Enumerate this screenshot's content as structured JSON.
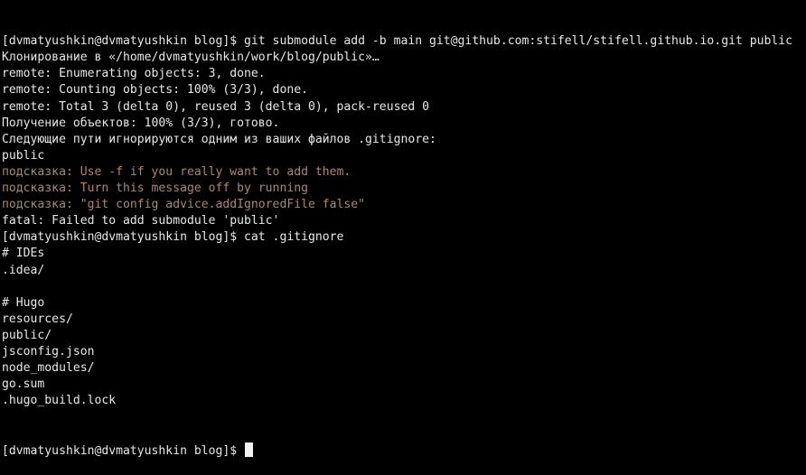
{
  "terminal": {
    "lines": [
      {
        "text": "[dvmatyushkin@dvmatyushkin blog]$ git submodule add -b main git@github.com:stifell/stifell.github.io.git public",
        "kind": "normal"
      },
      {
        "text": "Клонирование в «/home/dvmatyushkin/work/blog/public»…",
        "kind": "normal"
      },
      {
        "text": "remote: Enumerating objects: 3, done.",
        "kind": "normal"
      },
      {
        "text": "remote: Counting objects: 100% (3/3), done.",
        "kind": "normal"
      },
      {
        "text": "remote: Total 3 (delta 0), reused 3 (delta 0), pack-reused 0",
        "kind": "normal"
      },
      {
        "text": "Получение объектов: 100% (3/3), готово.",
        "kind": "normal"
      },
      {
        "text": "Следующие пути игнорируются одним из ваших файлов .gitignore:",
        "kind": "normal"
      },
      {
        "text": "public",
        "kind": "normal"
      },
      {
        "text": "подсказка: Use -f if you really want to add them.",
        "kind": "hint"
      },
      {
        "text": "подсказка: Turn this message off by running",
        "kind": "hint"
      },
      {
        "text": "подсказка: \"git config advice.addIgnoredFile false\"",
        "kind": "hint"
      },
      {
        "text": "fatal: Failed to add submodule 'public'",
        "kind": "normal"
      },
      {
        "text": "[dvmatyushkin@dvmatyushkin blog]$ cat .gitignore",
        "kind": "normal"
      },
      {
        "text": "# IDEs",
        "kind": "normal"
      },
      {
        "text": ".idea/",
        "kind": "normal"
      },
      {
        "text": "",
        "kind": "normal"
      },
      {
        "text": "# Hugo",
        "kind": "normal"
      },
      {
        "text": "resources/",
        "kind": "normal"
      },
      {
        "text": "public/",
        "kind": "normal"
      },
      {
        "text": "jsconfig.json",
        "kind": "normal"
      },
      {
        "text": "node_modules/",
        "kind": "normal"
      },
      {
        "text": "go.sum",
        "kind": "normal"
      },
      {
        "text": ".hugo_build.lock",
        "kind": "normal"
      }
    ],
    "prompt": "[dvmatyushkin@dvmatyushkin blog]$ ",
    "colors": {
      "background": "#000000",
      "foreground": "#e8e8e8",
      "hint": "#b0876a",
      "cursor": "#f2f2f2"
    }
  }
}
